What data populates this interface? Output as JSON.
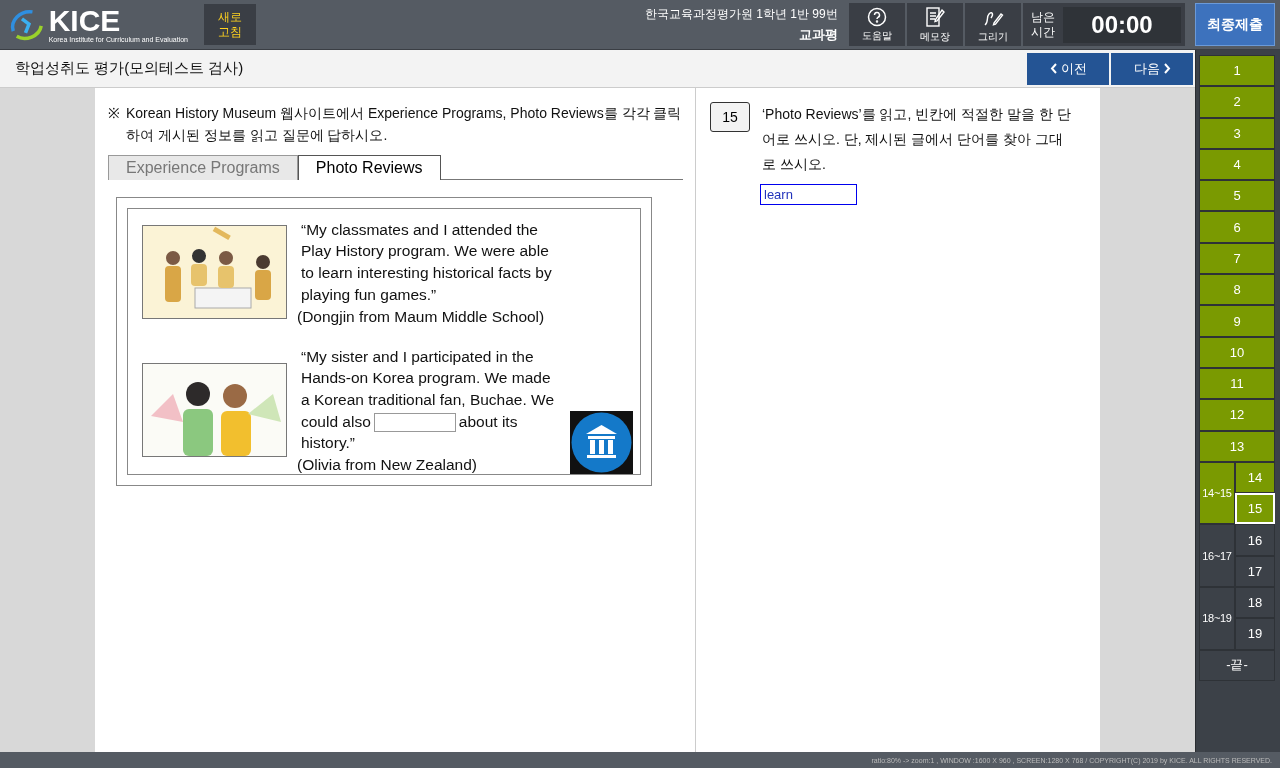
{
  "header": {
    "logo": {
      "wordmark": "KICE",
      "tagline": "Korea Institute for Curriculum and Evaluation"
    },
    "refresh_button": "새로 고침",
    "student": {
      "info": "한국교육과정평가원 1학년 1반 99번",
      "name": "교과평"
    },
    "tools": [
      {
        "kind": "help",
        "label": "도움말"
      },
      {
        "kind": "memo",
        "label": "메모장"
      },
      {
        "kind": "draw",
        "label": "그리기"
      }
    ],
    "timer": {
      "label": "남은 시간",
      "value": "00:00"
    },
    "submit_button": "최종제출"
  },
  "title": "학업성취도 평가(모의테스트 검사)",
  "nav": {
    "prev": "이전",
    "next": "다음"
  },
  "passage": {
    "mark": "※",
    "instruction": "Korean History Museum 웹사이트에서 Experience Programs, Photo Reviews를 각각 클릭하여 게시된 정보를 읽고 질문에 답하시오.",
    "tabs": [
      {
        "label": "Experience Programs",
        "selected": false
      },
      {
        "label": "Photo Reviews",
        "selected": true
      }
    ],
    "reviews": [
      {
        "quote_parts": [
          "“My classmates and I attended the Play History program. We were able to learn interesting historical facts by playing fun games.”"
        ],
        "author": "(Dongjin from Maum Middle School)"
      },
      {
        "quote_parts": [
          "“My sister and I participated in the Hands-on Korea program. We made a Korean traditional fan, Buchae. We could also",
          "about its history.”"
        ],
        "author": "(Olivia from New Zealand)"
      }
    ]
  },
  "question": {
    "number": "15",
    "text": "‘Photo Reviews’를 읽고, 빈칸에 적절한 말을 한 단어로 쓰시오. 단, 제시된 글에서 단어를 찾아 그대로 쓰시오.",
    "answer": "learn"
  },
  "sidebar": {
    "items": [
      {
        "kind": "item",
        "label": "1",
        "answered": true,
        "selected": false
      },
      {
        "kind": "item",
        "label": "2",
        "answered": true,
        "selected": false
      },
      {
        "kind": "item",
        "label": "3",
        "answered": true,
        "selected": false
      },
      {
        "kind": "item",
        "label": "4",
        "answered": true,
        "selected": false
      },
      {
        "kind": "item",
        "label": "5",
        "answered": true,
        "selected": false
      },
      {
        "kind": "item",
        "label": "6",
        "answered": true,
        "selected": false
      },
      {
        "kind": "item",
        "label": "7",
        "answered": true,
        "selected": false
      },
      {
        "kind": "item",
        "label": "8",
        "answered": true,
        "selected": false
      },
      {
        "kind": "item",
        "label": "9",
        "answered": true,
        "selected": false
      },
      {
        "kind": "item",
        "label": "10",
        "answered": true,
        "selected": false
      },
      {
        "kind": "item",
        "label": "11",
        "answered": true,
        "selected": false
      },
      {
        "kind": "item",
        "label": "12",
        "answered": true,
        "selected": false
      },
      {
        "kind": "item",
        "label": "13",
        "answered": true,
        "selected": false
      },
      {
        "kind": "group",
        "label": "14~15",
        "answered": true,
        "children": [
          {
            "label": "14",
            "answered": true,
            "selected": false
          },
          {
            "label": "15",
            "answered": true,
            "selected": true
          }
        ]
      },
      {
        "kind": "group",
        "label": "16~17",
        "answered": false,
        "children": [
          {
            "label": "16",
            "answered": false,
            "selected": false
          },
          {
            "label": "17",
            "answered": false,
            "selected": false
          }
        ]
      },
      {
        "kind": "group",
        "label": "18~19",
        "answered": false,
        "children": [
          {
            "label": "18",
            "answered": false,
            "selected": false
          },
          {
            "label": "19",
            "answered": false,
            "selected": false
          }
        ]
      },
      {
        "kind": "end",
        "label": "-끝-"
      }
    ]
  },
  "footer": "ratio:80% -> zoom:1 , WINDOW :1600 X 960 , SCREEN:1280 X 768 / COPYRIGHT(C) 2019 by KICE. ALL RIGHTS RESERVED."
}
